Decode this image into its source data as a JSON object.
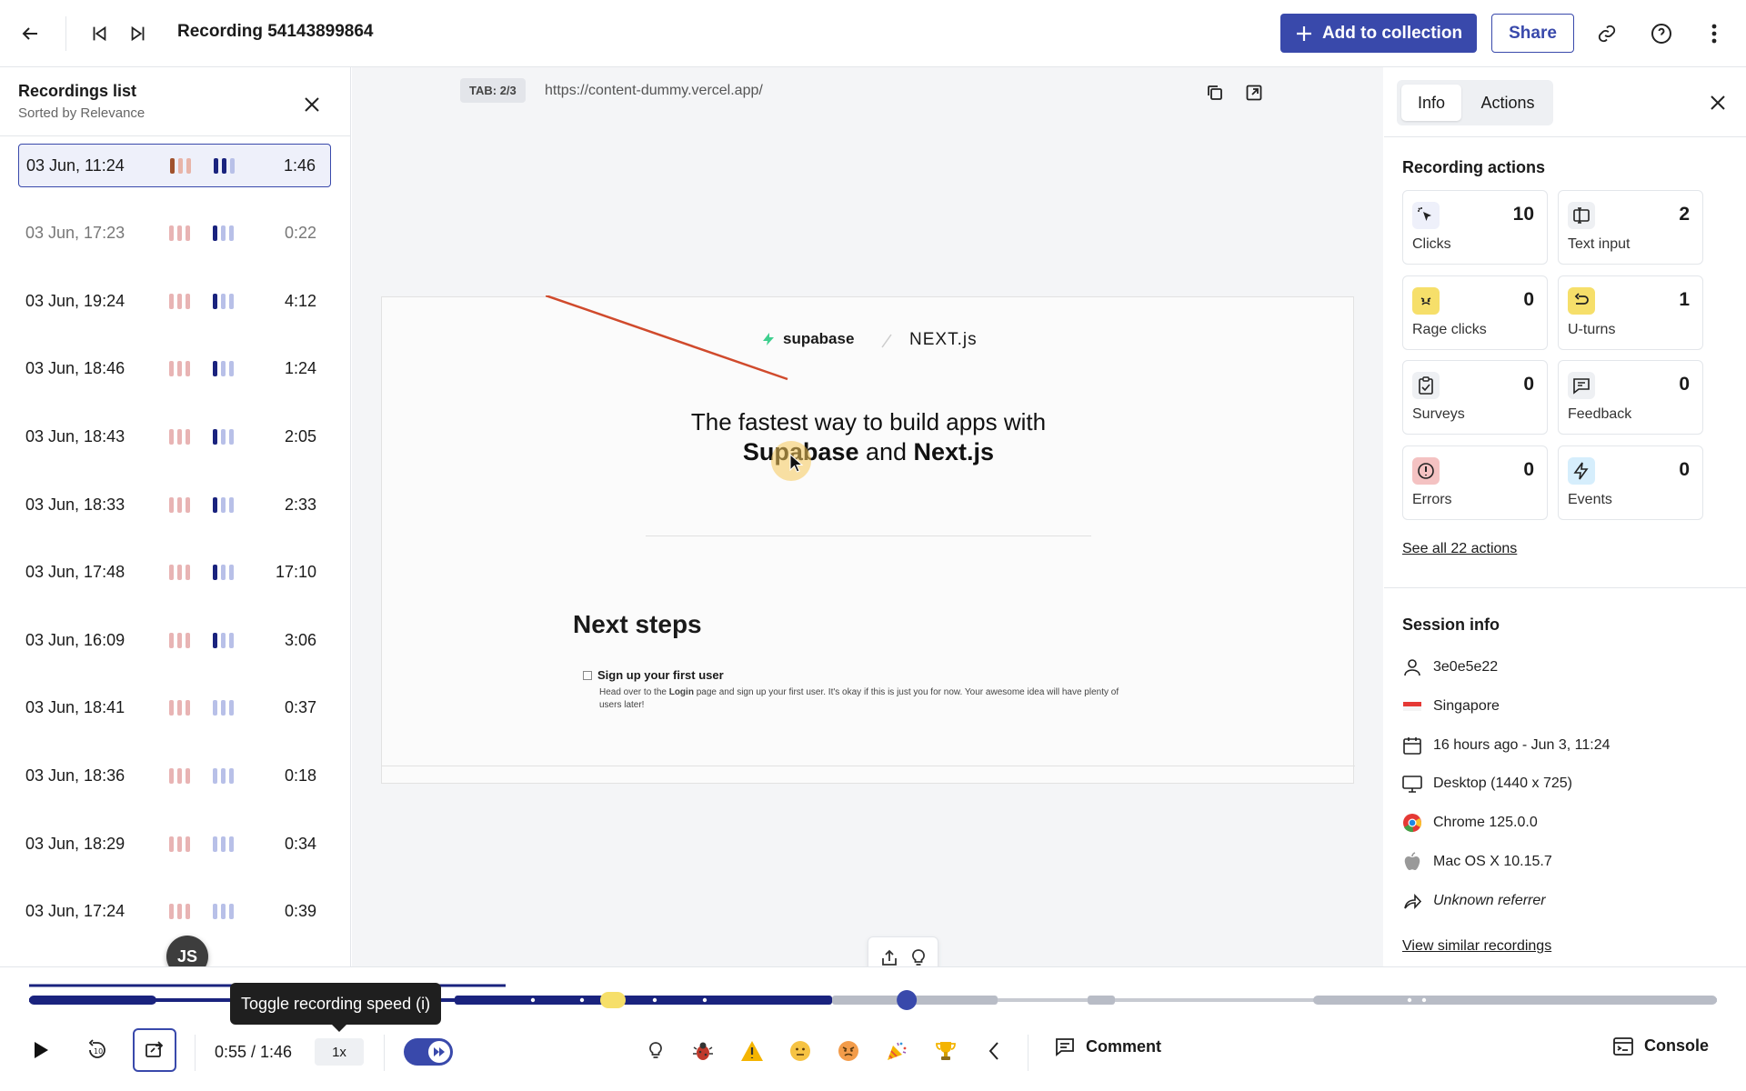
{
  "header": {
    "title": "Recording 54143899864",
    "add_label": "Add to collection",
    "share_label": "Share"
  },
  "left": {
    "title": "Recordings list",
    "subtitle": "Sorted by Relevance",
    "recordings": [
      {
        "date": "03 Jun, 11:24",
        "duration": "1:46"
      },
      {
        "date": "03 Jun, 17:23",
        "duration": "0:22"
      },
      {
        "date": "03 Jun, 19:24",
        "duration": "4:12"
      },
      {
        "date": "03 Jun, 18:46",
        "duration": "1:24"
      },
      {
        "date": "03 Jun, 18:43",
        "duration": "2:05"
      },
      {
        "date": "03 Jun, 18:33",
        "duration": "2:33"
      },
      {
        "date": "03 Jun, 17:48",
        "duration": "17:10"
      },
      {
        "date": "03 Jun, 16:09",
        "duration": "3:06"
      },
      {
        "date": "03 Jun, 18:41",
        "duration": "0:37"
      },
      {
        "date": "03 Jun, 18:36",
        "duration": "0:18"
      },
      {
        "date": "03 Jun, 18:29",
        "duration": "0:34"
      },
      {
        "date": "03 Jun, 17:24",
        "duration": "0:39"
      }
    ],
    "avatar": "JS"
  },
  "player": {
    "tab": "TAB: 2/3",
    "url": "https://content-dummy.vercel.app/",
    "page": {
      "brand": "supabase",
      "next_logo": "NEXT.js",
      "hero_line1": "The fastest way to build apps with",
      "hero_a": "Supabase",
      "hero_and": " and ",
      "hero_b": "Next.js",
      "next_steps": "Next steps",
      "step_title": "Sign up your first user",
      "step_desc_1": "Head over to the ",
      "step_desc_bold": "Login",
      "step_desc_2": " page and sign up your first user. It's okay if this is just you for now. Your awesome idea will have plenty of users later!"
    }
  },
  "right": {
    "tabs": [
      "Info",
      "Actions"
    ],
    "actions_title": "Recording actions",
    "cards": [
      {
        "label": "Clicks",
        "value": "10",
        "icon": "cursor-click-icon",
        "color": "#eef0fa"
      },
      {
        "label": "Text input",
        "value": "2",
        "icon": "text-input-icon",
        "color": "#eef0f3"
      },
      {
        "label": "Rage clicks",
        "value": "0",
        "icon": "angry-face-icon",
        "color": "#f6df6a"
      },
      {
        "label": "U-turns",
        "value": "1",
        "icon": "u-turn-icon",
        "color": "#f6df6a"
      },
      {
        "label": "Surveys",
        "value": "0",
        "icon": "clipboard-check-icon",
        "color": "#eef0f3"
      },
      {
        "label": "Feedback",
        "value": "0",
        "icon": "chat-icon",
        "color": "#eef0f3"
      },
      {
        "label": "Errors",
        "value": "0",
        "icon": "alert-circle-icon",
        "color": "#f4c2c2"
      },
      {
        "label": "Events",
        "value": "0",
        "icon": "lightning-icon",
        "color": "#d6eefc"
      }
    ],
    "see_all": "See all 22 actions",
    "session_title": "Session info",
    "session": [
      {
        "icon": "user-icon",
        "text": "3e0e5e22"
      },
      {
        "icon": "flag-icon",
        "text": "Singapore"
      },
      {
        "icon": "calendar-icon",
        "text": "16 hours ago - Jun 3, 11:24"
      },
      {
        "icon": "monitor-icon",
        "text": "Desktop (1440 x 725)"
      },
      {
        "icon": "chrome-icon",
        "text": "Chrome 125.0.0"
      },
      {
        "icon": "apple-icon",
        "text": "Mac OS X 10.15.7"
      },
      {
        "icon": "share-arrow-icon",
        "text": "Unknown referrer"
      }
    ],
    "view_similar": "View similar recordings"
  },
  "controls": {
    "tooltip": "Toggle recording speed (i)",
    "time": "0:55 / 1:46",
    "speed": "1x",
    "progress": 0.52,
    "comment": "Comment",
    "console": "Console",
    "emoji_icons": [
      "lightbulb-icon",
      "bug-icon",
      "warning-icon",
      "neutral-face-icon",
      "angry-face-icon",
      "party-icon",
      "trophy-icon"
    ]
  }
}
